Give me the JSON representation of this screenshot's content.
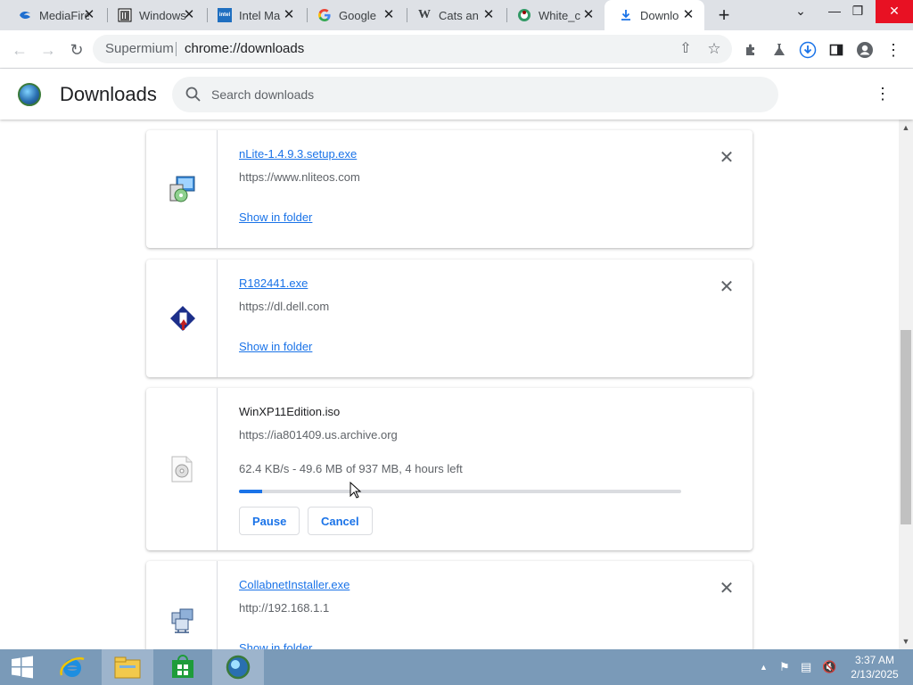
{
  "tabs": [
    {
      "title": "MediaFire",
      "favicon": "mediafire-icon",
      "close": "✕"
    },
    {
      "title": "Windows",
      "favicon": "archive-icon",
      "close": "✕"
    },
    {
      "title": "Intel Ma",
      "favicon": "intel-icon",
      "close": "✕"
    },
    {
      "title": "Google",
      "favicon": "google-icon",
      "close": "✕"
    },
    {
      "title": "Cats an",
      "favicon": "wikipedia-icon",
      "close": "✕"
    },
    {
      "title": "White_c",
      "favicon": "wikimedia-icon",
      "close": "✕"
    },
    {
      "title": "Downlo",
      "favicon": "download-icon",
      "close": "✕",
      "active": true
    }
  ],
  "window": {
    "new_tab": "+",
    "chevron": "⌄",
    "minimize": "—",
    "restore": "❐",
    "close": "✕"
  },
  "omnibox": {
    "chip": "Supermium",
    "url": "chrome://downloads"
  },
  "downloads_page": {
    "title": "Downloads",
    "search_placeholder": "Search downloads",
    "menu": "⋮"
  },
  "items": [
    {
      "filename": "nLite-1.4.9.3.setup.exe",
      "url": "https://www.nliteos.com",
      "action": "Show in folder",
      "icon": "installer-icon",
      "remove": "✕"
    },
    {
      "filename": "R182441.exe",
      "url": "https://dl.dell.com",
      "action": "Show in folder",
      "icon": "dell-installer-icon",
      "remove": "✕"
    },
    {
      "filename": "WinXP11Edition.iso",
      "url": "https://ia801409.us.archive.org",
      "status": "62.4 KB/s - 49.6 MB of 937 MB, 4 hours left",
      "progress_fraction": 0.053,
      "pause": "Pause",
      "cancel": "Cancel",
      "icon": "disc-image-icon"
    },
    {
      "filename": "CollabnetInstaller.exe",
      "url": "http://192.168.1.1",
      "action": "Show in folder",
      "icon": "network-installer-icon",
      "remove": "✕"
    }
  ],
  "taskbar": {
    "apps": [
      "start-icon",
      "internet-explorer-icon",
      "file-explorer-icon",
      "store-icon",
      "supermium-icon"
    ],
    "time": "3:37 AM",
    "date": "2/13/2025"
  },
  "colors": {
    "accent": "#1a73e8",
    "tabstrip": "#dee1e6",
    "taskbar": "#7a9ab8"
  }
}
